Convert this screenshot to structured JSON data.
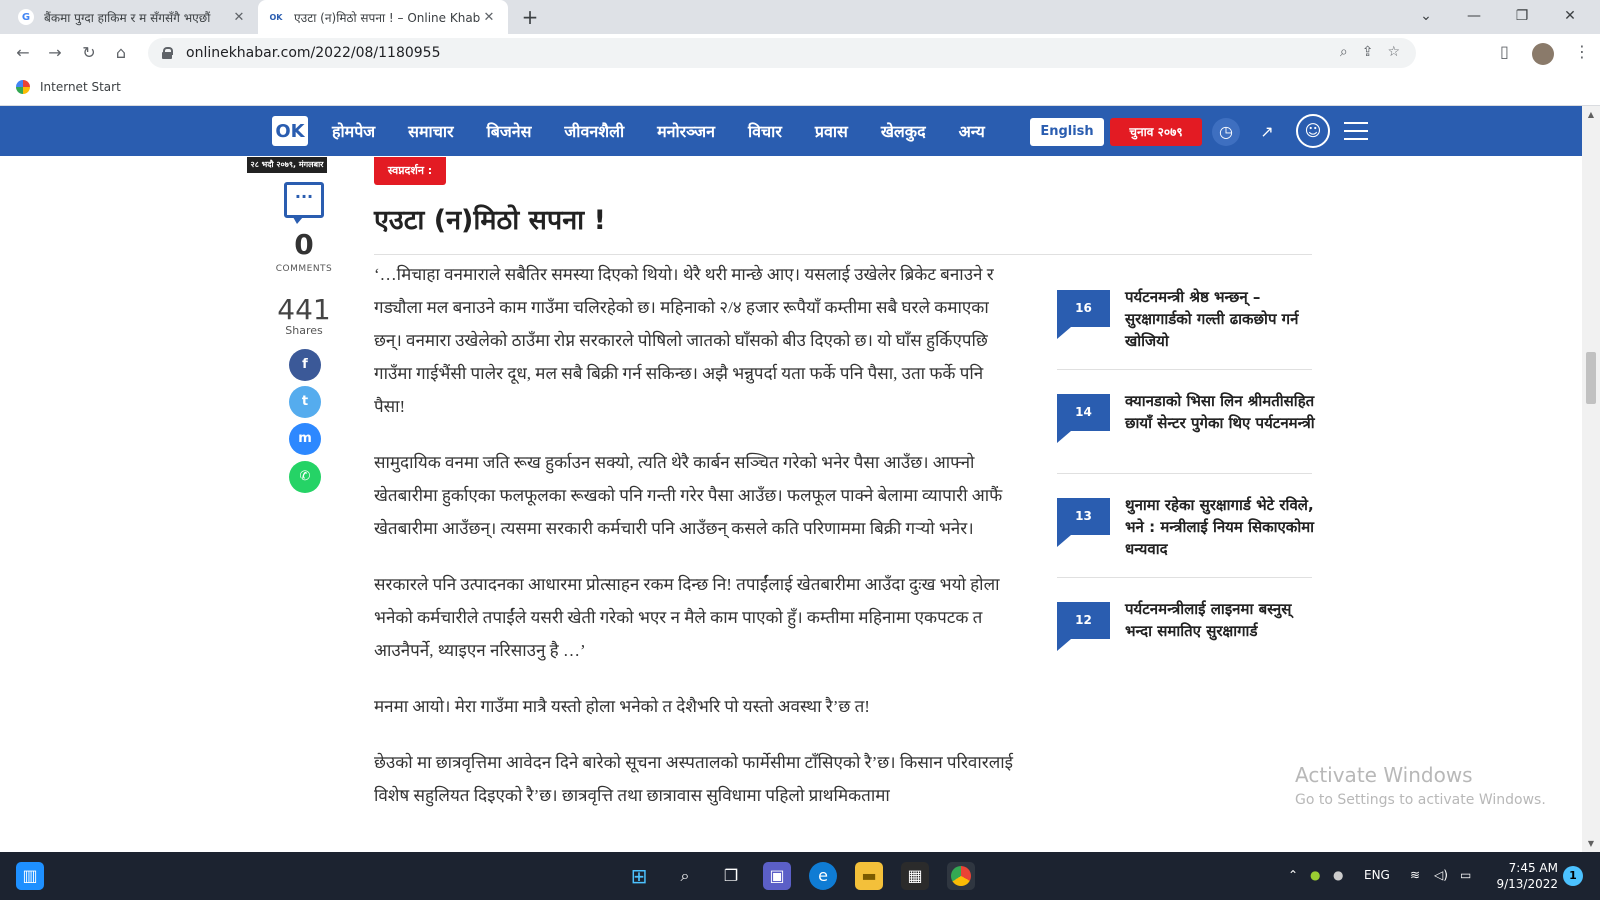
{
  "browser": {
    "tabs": [
      {
        "title": "बैंकमा पुग्दा हाकिम र म सँगसँगै भएछौं",
        "favicon": "G",
        "active": false
      },
      {
        "title": "एउटा (न)मिठो सपना ! – Online Khabar",
        "favicon": "OK",
        "active": true
      }
    ],
    "url": "onlinekhabar.com/2022/08/1180955",
    "bookmark": "Internet Start"
  },
  "site": {
    "logo": "OK",
    "nav": [
      "होमपेज",
      "समाचार",
      "बिजनेस",
      "जीवनशैली",
      "मनोरञ्जन",
      "विचार",
      "प्रवास",
      "खेलकुद",
      "अन्य"
    ],
    "english_button": "English",
    "election_button": "चुनाव २०७९"
  },
  "share": {
    "date": "२८ भदौ २०७९, मंगलबार",
    "comment_count": "0",
    "comment_label": "COMMENTS",
    "share_count": "441",
    "share_label": "Shares",
    "icons": [
      "facebook-icon",
      "twitter-icon",
      "messenger-icon",
      "whatsapp-icon"
    ]
  },
  "article": {
    "category": "स्वप्नदर्शन :",
    "headline": "एउटा (न)मिठो सपना !",
    "paragraphs": [
      "‘…मिचाहा वनमाराले सबैतिर समस्या दिएको थियो। थेरै थरी मान्छे आए। यसलाई उखेलेर ब्रिकेट बनाउने र गड्यौला मल बनाउने काम गाउँमा चलिरहेको छ। महिनाको २/४ हजार रूपैयाँ कम्तीमा सबै घरले कमाएका छन्। वनमारा उखेलेको ठाउँमा रोप्न सरकारले पोषिलो जातको घाँसको बीउ दिएको छ। यो घाँस हुर्किएपछि गाउँमा गाईभैंसी पालेर दूध, मल सबै बिक्री गर्न सकिन्छ। अझै भन्नुपर्दा यता फर्के पनि पैसा, उता फर्के पनि पैसा!",
      "सामुदायिक वनमा जति रूख हुर्काउन सक्यो, त्यति थेरै कार्बन सञ्चित गरेको भनेर पैसा आउँछ। आफ्नो खेतबारीमा हुर्काएका फलफूलका रूखको पनि गन्ती गरेर पैसा आउँछ। फलफूल पाक्ने बेलामा व्यापारी आफैं खेतबारीमा आउँछन्। त्यसमा सरकारी कर्मचारी पनि आउँछन् कसले कति परिणाममा बिक्री गऱ्यो भनेर।",
      "सरकारले पनि उत्पादनका आधारमा प्रोत्साहन रकम दिन्छ नि! तपाईंलाई खेतबारीमा आउँदा दुःख भयो होला भनेको कर्मचारीले तपाईंले यसरी खेती गरेको भएर न मैले काम पाएको हुँ। कम्तीमा महिनामा एकपटक त आउनैपर्ने, थ्याइएन नरिसाउनु है …’",
      "मनमा आयो। मेरा गाउँमा मात्रै यस्तो होला भनेको त देशैभरि पो यस्तो अवस्था रै’छ त!",
      "छेउको  मा छात्रवृत्तिमा आवेदन दिने बारेको सूचना अस्पतालको फार्मेसीमा टाँसिएको रै’छ। किसान परिवारलाई विशेष सहुलियत दिइएको रै’छ। छात्रवृत्ति तथा छात्रावास सुविधामा पहिलो प्राथमिकतामा"
    ]
  },
  "trending": [
    {
      "num": "16",
      "title": "पर्यटनमन्त्री श्रेष्ठ भन्छन् – सुरक्षागार्डको गल्ती ढाकछोप गर्न खोजियो"
    },
    {
      "num": "14",
      "title": "क्यानडाको भिसा लिन श्रीमतीसहित छायाँ सेन्टर पुगेका थिए पर्यटनमन्त्री"
    },
    {
      "num": "13",
      "title": "थुनामा रहेका सुरक्षागार्ड भेटे रविले, भने : मन्त्रीलाई नियम सिकाएकोमा धन्यवाद"
    },
    {
      "num": "12",
      "title": "पर्यटनमन्त्रीलाई लाइनमा बस्नुस् भन्दा समातिए सुरक्षागार्ड"
    }
  ],
  "watermark": {
    "line1": "Activate Windows",
    "line2": "Go to Settings to activate Windows."
  },
  "taskbar": {
    "lang": "ENG",
    "time": "7:45 AM",
    "date": "9/13/2022",
    "notifications": "1"
  },
  "colors": {
    "brand_blue": "#2a5db0",
    "brand_red": "#e31b23"
  }
}
